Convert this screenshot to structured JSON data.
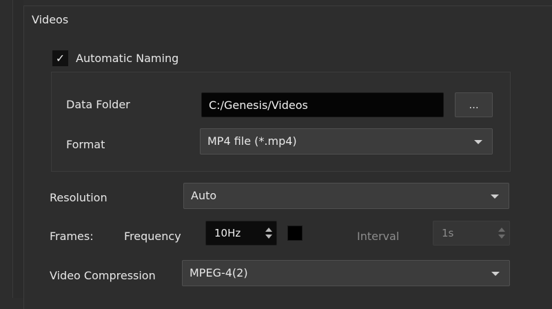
{
  "videos_group": {
    "title": "Videos",
    "automatic_naming": {
      "label": "Automatic Naming",
      "checked": true,
      "check_glyph": "✓"
    },
    "data_folder": {
      "label": "Data Folder",
      "value": "C:/Genesis/Videos",
      "browse_label": "..."
    },
    "format": {
      "label": "Format",
      "selected": "MP4 file (*.mp4)"
    },
    "resolution": {
      "label": "Resolution",
      "selected": "Auto"
    },
    "frames": {
      "label": "Frames:",
      "frequency_label": "Frequency",
      "frequency_value": "10Hz",
      "color_swatch": "#000000",
      "interval_label": "Interval",
      "interval_value": "1s"
    },
    "video_compression": {
      "label": "Video Compression",
      "selected": "MPEG-4(2)"
    }
  }
}
